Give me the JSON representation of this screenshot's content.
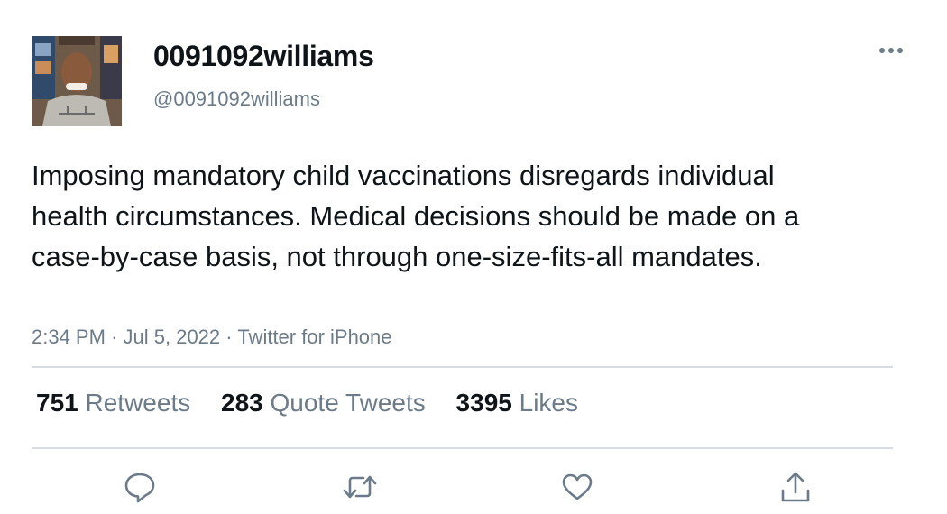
{
  "author": {
    "display_name": "0091092williams",
    "handle": "@0091092williams"
  },
  "tweet": {
    "text": "Imposing mandatory child vaccinations disregards individual health circumstances. Medical decisions should be made on a case-by-case basis, not through one-size-fits-all mandates.",
    "time": "2:34 PM",
    "separator": "·",
    "date": "Jul 5, 2022",
    "source": "Twitter for iPhone"
  },
  "stats": {
    "retweets_count": "751",
    "retweets_label": "Retweets",
    "quotes_count": "283",
    "quotes_label": "Quote Tweets",
    "likes_count": "3395",
    "likes_label": "Likes"
  },
  "icons": {
    "more": "more-horizontal-icon",
    "reply": "reply-icon",
    "retweet": "retweet-icon",
    "like": "heart-icon",
    "share": "share-icon"
  },
  "colors": {
    "text": "#0f1419",
    "secondary": "#6b7b8a",
    "divider": "#d8dde1"
  }
}
